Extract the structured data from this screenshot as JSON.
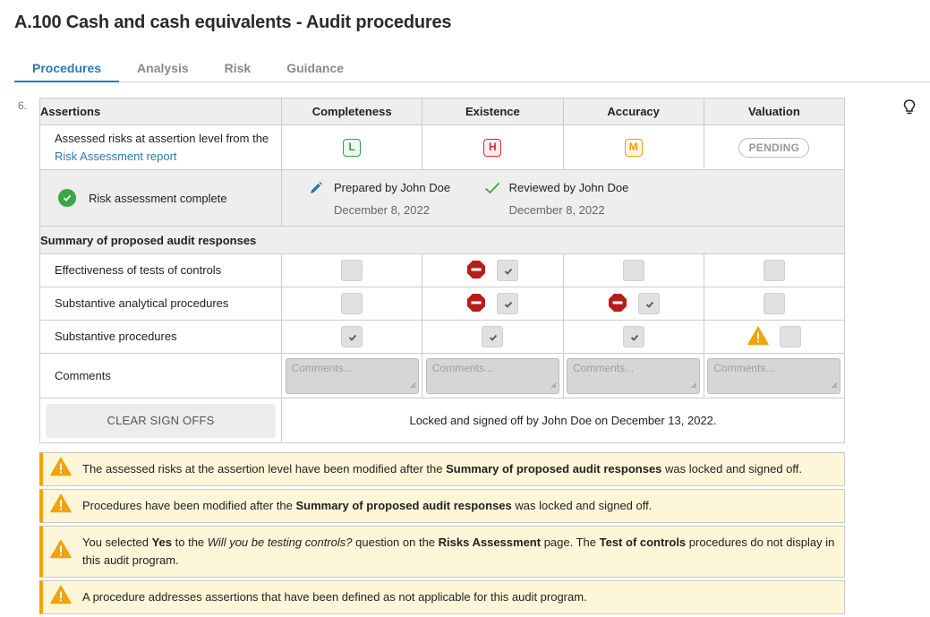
{
  "page": {
    "title": "A.100 Cash and cash equivalents - Audit procedures"
  },
  "tabs": [
    {
      "label": "Procedures",
      "active": true
    },
    {
      "label": "Analysis",
      "active": false
    },
    {
      "label": "Risk",
      "active": false
    },
    {
      "label": "Guidance",
      "active": false
    }
  ],
  "step_number": "6.",
  "icons": {
    "lightbulb": "lightbulb-icon",
    "pencil": "pencil-icon",
    "check": "check-icon",
    "check_circle": "check-circle-icon",
    "stop": "stop-icon",
    "warning": "warning-icon"
  },
  "colors": {
    "accent": "#2a7ab3",
    "low": "#3a9a45",
    "high": "#d03030",
    "medium": "#ef9f00",
    "stop": "#b71c1c",
    "warning": "#f0a30a",
    "alert_bg": "#fdf6d8"
  },
  "table": {
    "header_first": "Assertions",
    "columns": [
      "Completeness",
      "Existence",
      "Accuracy",
      "Valuation"
    ],
    "risk_row": {
      "label_prefix": "Assessed risks at assertion level from the ",
      "label_link": "Risk Assessment report",
      "values": [
        {
          "type": "badge",
          "level": "low",
          "text": "L"
        },
        {
          "type": "badge",
          "level": "high",
          "text": "H"
        },
        {
          "type": "badge",
          "level": "med",
          "text": "M"
        },
        {
          "type": "pending",
          "text": "PENDING"
        }
      ]
    },
    "signoff_row": {
      "label": "Risk assessment complete",
      "prepared": {
        "who": "Prepared by John Doe",
        "when": "December 8, 2022"
      },
      "reviewed": {
        "who": "Reviewed by John Doe",
        "when": "December 8, 2022"
      }
    },
    "summary_heading": "Summary of proposed audit responses",
    "responses": [
      {
        "label": "Effectiveness of tests of controls",
        "cells": [
          {
            "checked": false,
            "flag": null
          },
          {
            "checked": true,
            "flag": "stop"
          },
          {
            "checked": false,
            "flag": null
          },
          {
            "checked": false,
            "flag": null
          }
        ]
      },
      {
        "label": "Substantive analytical procedures",
        "cells": [
          {
            "checked": false,
            "flag": null
          },
          {
            "checked": true,
            "flag": "stop"
          },
          {
            "checked": true,
            "flag": "stop"
          },
          {
            "checked": false,
            "flag": null
          }
        ]
      },
      {
        "label": "Substantive procedures",
        "cells": [
          {
            "checked": true,
            "flag": null
          },
          {
            "checked": true,
            "flag": null
          },
          {
            "checked": true,
            "flag": null
          },
          {
            "checked": false,
            "flag": "warning"
          }
        ]
      }
    ],
    "comments_label": "Comments",
    "comment_placeholder": "Comments...",
    "clear_button": "CLEAR SIGN OFFS",
    "locked_text": "Locked and signed off by John Doe on December 13, 2022."
  },
  "alerts": [
    {
      "parts": [
        {
          "t": "The assessed risks at the assertion level have been modified after the ",
          "s": "n"
        },
        {
          "t": "Summary of proposed audit responses",
          "s": "b"
        },
        {
          "t": " was locked and signed off.",
          "s": "n"
        }
      ]
    },
    {
      "parts": [
        {
          "t": "Procedures have been modified after the ",
          "s": "n"
        },
        {
          "t": "Summary of proposed audit responses",
          "s": "b"
        },
        {
          "t": " was locked and signed off.",
          "s": "n"
        }
      ]
    },
    {
      "parts": [
        {
          "t": "You selected ",
          "s": "n"
        },
        {
          "t": "Yes",
          "s": "b"
        },
        {
          "t": " to the ",
          "s": "n"
        },
        {
          "t": "Will you be testing controls?",
          "s": "i"
        },
        {
          "t": " question on the ",
          "s": "n"
        },
        {
          "t": "Risks Assessment",
          "s": "b"
        },
        {
          "t": " page. The ",
          "s": "n"
        },
        {
          "t": "Test of controls",
          "s": "b"
        },
        {
          "t": " procedures do not display in this audit program.",
          "s": "n"
        }
      ]
    },
    {
      "parts": [
        {
          "t": "A procedure addresses assertions that have been defined as not applicable for this audit program.",
          "s": "n"
        }
      ]
    }
  ]
}
